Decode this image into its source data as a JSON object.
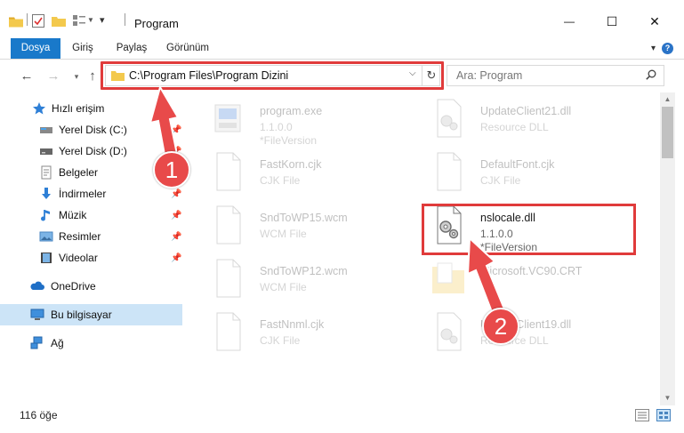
{
  "window": {
    "title": "Program",
    "minimize": "—",
    "maximize": "☐",
    "close": "✕"
  },
  "ribbon": {
    "tabs": [
      "Dosya",
      "Giriş",
      "Paylaş",
      "Görünüm"
    ],
    "help": "?"
  },
  "address": {
    "path": "C:\\Program Files\\Program Dizini",
    "search_placeholder": "Ara: Program"
  },
  "nav": {
    "quick_access": "Hızlı erişim",
    "items": [
      {
        "label": "Yerel Disk (C:)",
        "pinned": true
      },
      {
        "label": "Yerel Disk (D:)",
        "pinned": true
      },
      {
        "label": "Belgeler",
        "pinned": true
      },
      {
        "label": "İndirmeler",
        "pinned": true
      },
      {
        "label": "Müzik",
        "pinned": true
      },
      {
        "label": "Resimler",
        "pinned": true
      },
      {
        "label": "Videolar",
        "pinned": true
      }
    ],
    "onedrive": "OneDrive",
    "this_pc": "Bu bilgisayar",
    "network": "Ağ"
  },
  "files": {
    "left": [
      {
        "name": "program.exe",
        "sub1": "1.1.0.0",
        "sub2": "*FileVersion"
      },
      {
        "name": "FastKorn.cjk",
        "sub1": "CJK File",
        "sub2": ""
      },
      {
        "name": "SndToWP15.wcm",
        "sub1": "WCM File",
        "sub2": ""
      },
      {
        "name": "SndToWP12.wcm",
        "sub1": "WCM File",
        "sub2": ""
      },
      {
        "name": "FastNnml.cjk",
        "sub1": "CJK File",
        "sub2": ""
      }
    ],
    "right": [
      {
        "name": "UpdateClient21.dll",
        "sub1": "Resource DLL",
        "sub2": ""
      },
      {
        "name": "DefaultFont.cjk",
        "sub1": "CJK File",
        "sub2": ""
      },
      {
        "name": "nslocale.dll",
        "sub1": "1.1.0.0",
        "sub2": "*FileVersion"
      },
      {
        "name": "Microsoft.VC90.CRT",
        "sub1": "",
        "sub2": ""
      },
      {
        "name": "UpdateClient19.dll",
        "sub1": "Resource DLL",
        "sub2": ""
      }
    ]
  },
  "callouts": [
    "1",
    "2"
  ],
  "status": {
    "count": "116 öğe"
  },
  "colors": {
    "accent": "#1979ca",
    "highlight": "#e03b3b",
    "badge": "#e84a4a",
    "selected": "#cce4f7",
    "folder": "#f3c94d"
  }
}
